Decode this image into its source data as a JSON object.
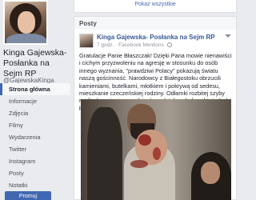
{
  "page": {
    "name": "Kinga Gajewska-Posłanka na Sejm RP",
    "handle": "@GajewskaKinga"
  },
  "nav": [
    {
      "label": "Strona główna",
      "active": true
    },
    {
      "label": "Informacje",
      "active": false
    },
    {
      "label": "Zdjęcia",
      "active": false
    },
    {
      "label": "Filmy",
      "active": false
    },
    {
      "label": "Wydarzenia",
      "active": false
    },
    {
      "label": "Twitter",
      "active": false
    },
    {
      "label": "Instagram",
      "active": false
    },
    {
      "label": "Posty",
      "active": false
    },
    {
      "label": "Notatki",
      "active": false
    },
    {
      "label": "Społeczność",
      "active": false
    }
  ],
  "promote_label": "Promuj",
  "topcard": {
    "see_all": "Pokaż wszystkie"
  },
  "posts_section": {
    "title": "Posty"
  },
  "post": {
    "author": "Kinga Gajewska- Posłanka na Sejm RP",
    "time": "7 godz.",
    "source": "Facebook Mentions",
    "text": "Gratulacje Panie Błaszczak! Dzięki Pana mowie nienawiści i cichym przyzwoleniu na agresję w stosunku do osób innego wyznania, \"prawdziwi Polacy\" pokazują światu naszą gościnność. Narodowcy z Białegostoku obrzucili kamieniami, butelkami, młotkiem i pokrywą od sedesu, mieszkanie czeczeńskiej rodziny. Odłamki rozbitej szyby raniły dwumiesięczne dziecko, młotek wylądował tuż obok łóżeczka."
  },
  "icons": {
    "globe": "globe-icon",
    "menu": "chevron-down-icon"
  },
  "colors": {
    "brand": "#4267b2",
    "link": "#365899",
    "background": "#e9ebee"
  }
}
